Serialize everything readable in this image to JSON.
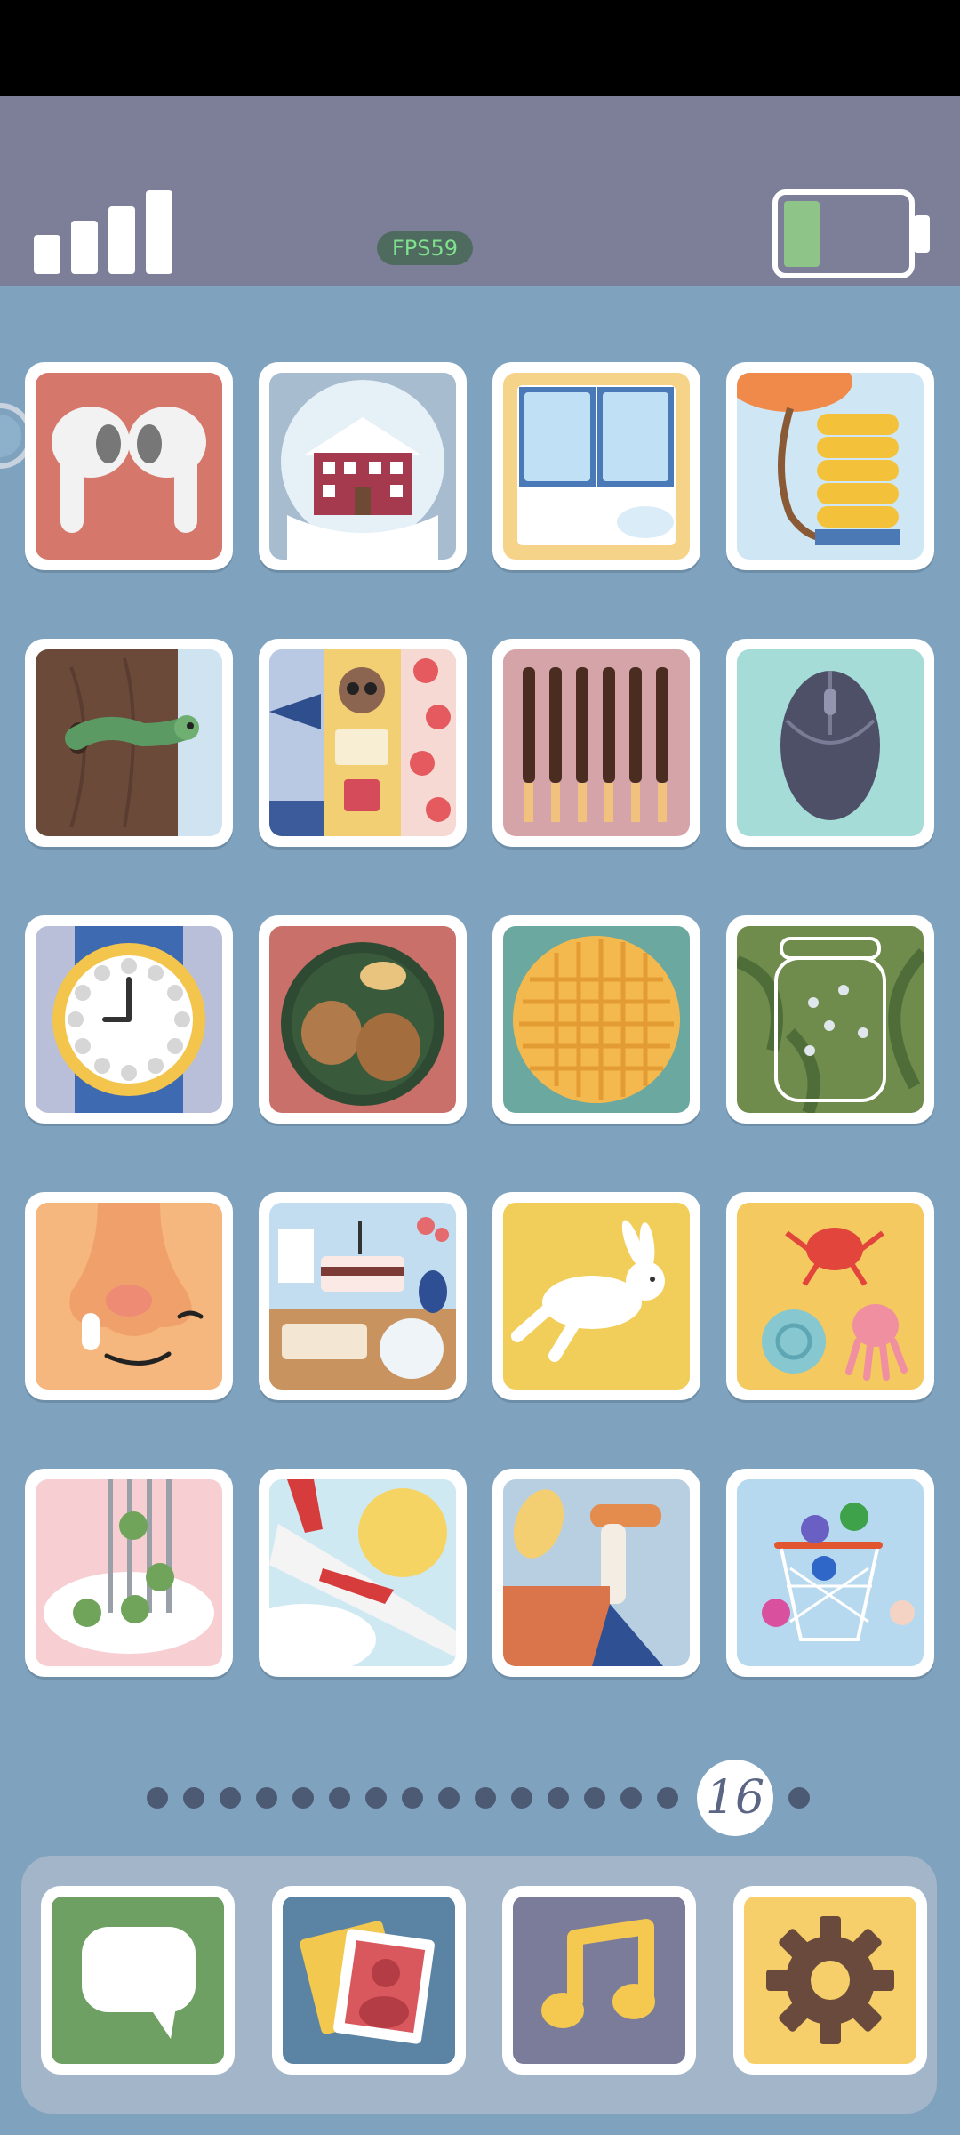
{
  "status_bar": {
    "fps_label": "FPS59",
    "signal_icon": "signal-bars-icon",
    "battery_icon": "battery-icon",
    "battery_level": 0.25
  },
  "home_grid": {
    "rows": 5,
    "columns": 4,
    "apps": [
      {
        "icon": "earbuds-icon"
      },
      {
        "icon": "snow-globe-house-icon"
      },
      {
        "icon": "window-icon"
      },
      {
        "icon": "balloon-pump-icon"
      },
      {
        "icon": "tree-worm-icon"
      },
      {
        "icon": "raccoon-strawberry-icon"
      },
      {
        "icon": "chocolate-sticks-icon"
      },
      {
        "icon": "computer-mouse-icon"
      },
      {
        "icon": "wrist-watch-icon"
      },
      {
        "icon": "nuts-plate-icon"
      },
      {
        "icon": "waffle-icon"
      },
      {
        "icon": "firefly-jar-icon"
      },
      {
        "icon": "nose-face-icon"
      },
      {
        "icon": "birthday-cake-icon"
      },
      {
        "icon": "jumping-rabbit-icon"
      },
      {
        "icon": "sea-creatures-icon"
      },
      {
        "icon": "fork-peas-icon"
      },
      {
        "icon": "airplane-wing-icon"
      },
      {
        "icon": "spoon-pot-icon"
      },
      {
        "icon": "basketball-hoop-icon"
      }
    ]
  },
  "pagination": {
    "total_dots": 16,
    "current_page_label": "16"
  },
  "dock": {
    "apps": [
      {
        "icon": "messages-icon",
        "bg": "#6fa063"
      },
      {
        "icon": "photos-icon",
        "bg": "#5b83a3"
      },
      {
        "icon": "music-icon",
        "bg": "#7b7c99"
      },
      {
        "icon": "settings-gear-icon",
        "bg": "#f7cf6a"
      }
    ]
  },
  "colors": {
    "background": "#7fa3bf",
    "status_bar": "#7d7f99",
    "dock": "#a3b5c8"
  }
}
